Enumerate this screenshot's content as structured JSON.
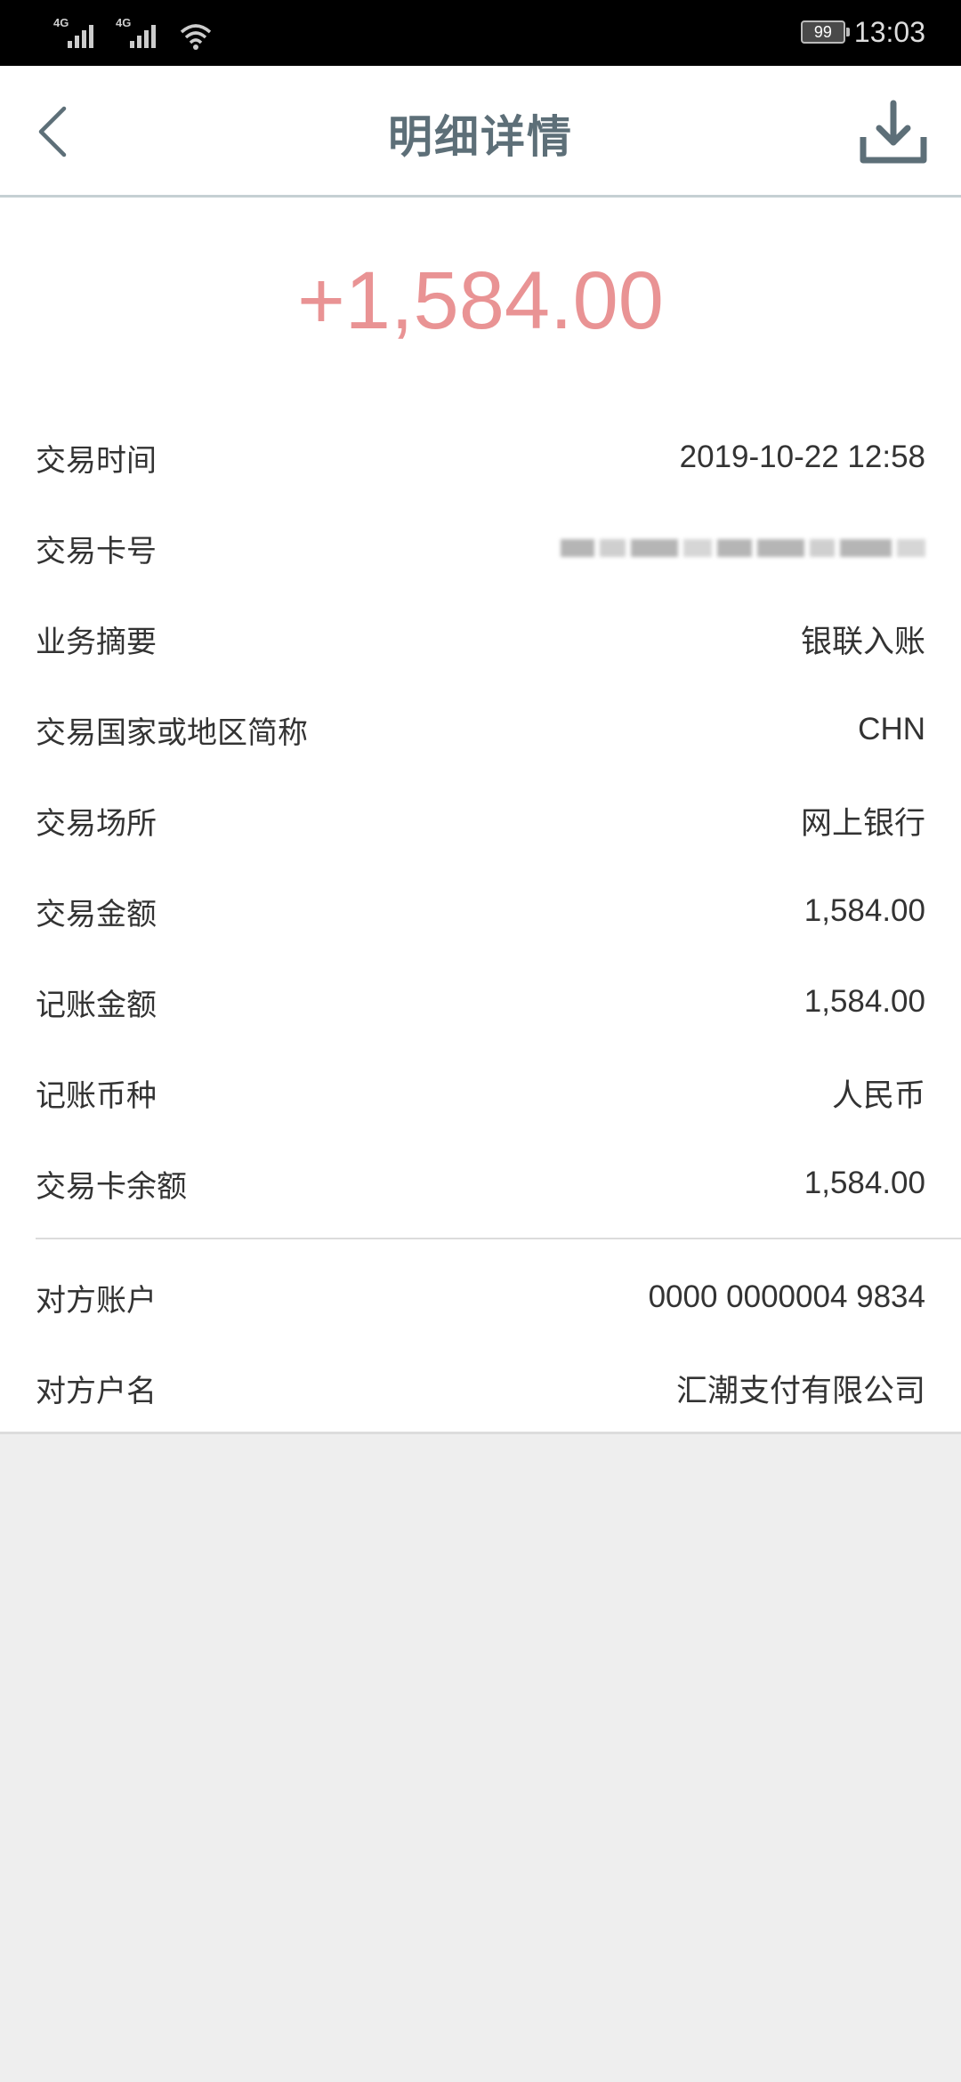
{
  "status_bar": {
    "network_1": "4G",
    "network_2": "4G",
    "battery": "99",
    "time": "13:03"
  },
  "nav": {
    "title": "明细详情",
    "back_icon": "chevron-left-icon",
    "download_icon": "download-icon"
  },
  "amount": "+1,584.00",
  "colors": {
    "amount": "#e99394",
    "title": "#5d6f78",
    "background": "#eeeeee"
  },
  "details": [
    {
      "label": "交易时间",
      "value": "2019-10-22 12:58"
    },
    {
      "label": "交易卡号",
      "value": ""
    },
    {
      "label": "业务摘要",
      "value": "银联入账"
    },
    {
      "label": "交易国家或地区简称",
      "value": "CHN"
    },
    {
      "label": "交易场所",
      "value": "网上银行"
    },
    {
      "label": "交易金额",
      "value": "1,584.00"
    },
    {
      "label": "记账金额",
      "value": "1,584.00"
    },
    {
      "label": "记账币种",
      "value": "人民币"
    },
    {
      "label": "交易卡余额",
      "value": "1,584.00"
    }
  ],
  "counterparty": [
    {
      "label": "对方账户",
      "value": "0000 0000004 9834"
    },
    {
      "label": "对方户名",
      "value": "汇潮支付有限公司"
    }
  ]
}
